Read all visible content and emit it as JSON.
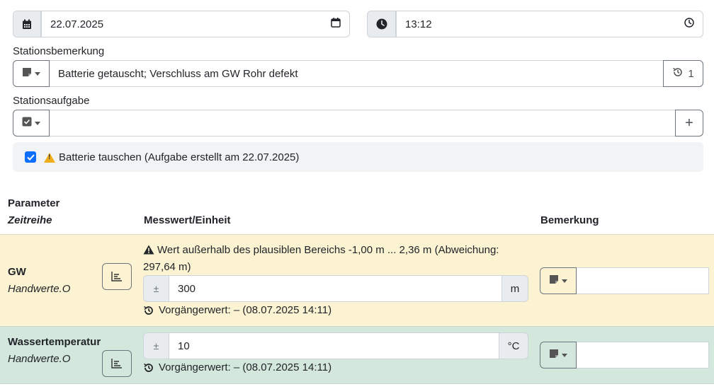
{
  "date_field": {
    "value": "22.07.2025",
    "icon": "calendar-icon",
    "picker_icon": "calendar-picker-icon"
  },
  "time_field": {
    "value": "13:12",
    "icon": "clock-icon",
    "picker_icon": "clock-picker-icon"
  },
  "station_remark": {
    "label": "Stationsbemerkung",
    "value": "Batterie getauscht; Verschluss am GW Rohr defekt",
    "history_count": "1"
  },
  "station_task": {
    "label": "Stationsaufgabe",
    "value": "",
    "add_label": "+"
  },
  "task_item": {
    "checked": true,
    "text": "Batterie tauschen (Aufgabe erstellt am 22.07.2025)"
  },
  "table": {
    "headers": {
      "parameter": "Parameter",
      "series": "Zeitreihe",
      "value_unit": "Messwert/Einheit",
      "remark": "Bemerkung"
    },
    "rows": [
      {
        "name": "GW",
        "series": "Handwerte.O",
        "warning": "Wert außerhalb des plausiblen Bereichs -1,00 m ... 2,36 m (Abweichung: 297,64 m)",
        "prefix": "±",
        "value": "300",
        "unit": "m",
        "previous": "Vorgängerwert: – (08.07.2025 14:11)",
        "remark": ""
      },
      {
        "name": "Wassertemperatur",
        "series": "Handwerte.O",
        "prefix": "±",
        "value": "10",
        "unit": "°C",
        "previous": "Vorgängerwert: – (08.07.2025 14:11)",
        "remark": ""
      }
    ]
  },
  "colors": {
    "warning_row": "#fcf3d2",
    "ok_row": "#d3e7dc",
    "checkbox": "#0d6efd"
  }
}
